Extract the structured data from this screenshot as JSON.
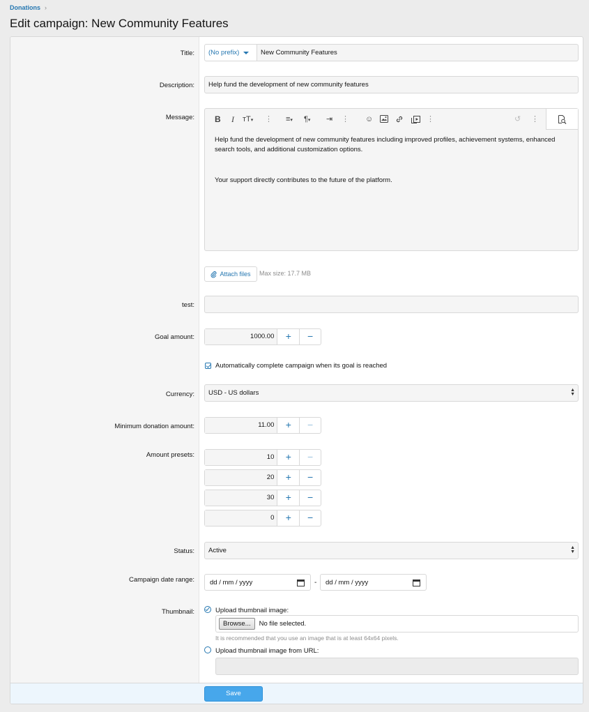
{
  "breadcrumb": {
    "item": "Donations",
    "separator": "›"
  },
  "page_title": "Edit campaign: New Community Features",
  "form": {
    "title": {
      "label": "Title:",
      "prefix": "(No prefix)",
      "value": "New Community Features"
    },
    "description": {
      "label": "Description:",
      "value": "Help fund the development of new community features"
    },
    "message": {
      "label": "Message:",
      "paragraph_1": "Help fund the development of new community features including improved profiles, achievement systems, enhanced search tools, and additional customization options.",
      "paragraph_2": "Your support directly contributes to the future of the platform.",
      "toolbar": [
        "bold-icon",
        "italic-icon",
        "text-size-icon",
        "more-icon",
        "align-icon",
        "paragraph-icon",
        "list-icon",
        "more-icon",
        "smilie-icon",
        "image-icon",
        "link-icon",
        "media-icon",
        "more-icon",
        "undo-icon",
        "more-icon",
        "preview-icon"
      ]
    },
    "attach": {
      "label": "Attach files",
      "max_size": "Max size: 17.7 MB"
    },
    "test": {
      "label": "test:",
      "value": ""
    },
    "goal_amount": {
      "label": "Goal amount:",
      "value": "1000.00"
    },
    "auto_complete": {
      "label": "Automatically complete campaign when its goal is reached",
      "checked": true
    },
    "currency": {
      "label": "Currency:",
      "value": "USD - US dollars"
    },
    "min_donation": {
      "label": "Minimum donation amount:",
      "value": "11.00"
    },
    "amount_presets": {
      "label": "Amount presets:",
      "values": [
        "10",
        "20",
        "30",
        "0"
      ]
    },
    "status": {
      "label": "Status:",
      "value": "Active"
    },
    "date_range": {
      "label": "Campaign date range:",
      "start_placeholder": "dd / mm / yyyy",
      "end_placeholder": "dd / mm / yyyy",
      "separator": "-"
    },
    "thumbnail": {
      "label": "Thumbnail:",
      "upload_label": "Upload thumbnail image:",
      "browse": "Browse...",
      "no_file": "No file selected.",
      "hint": "It is recommended that you use an image that is at least 64x64 pixels.",
      "url_label": "Upload thumbnail image from URL:",
      "url_value": ""
    },
    "save": "Save"
  },
  "colors": {
    "accent": "#2577b1",
    "button": "#47a7eb",
    "footer": "#edf6fd"
  }
}
